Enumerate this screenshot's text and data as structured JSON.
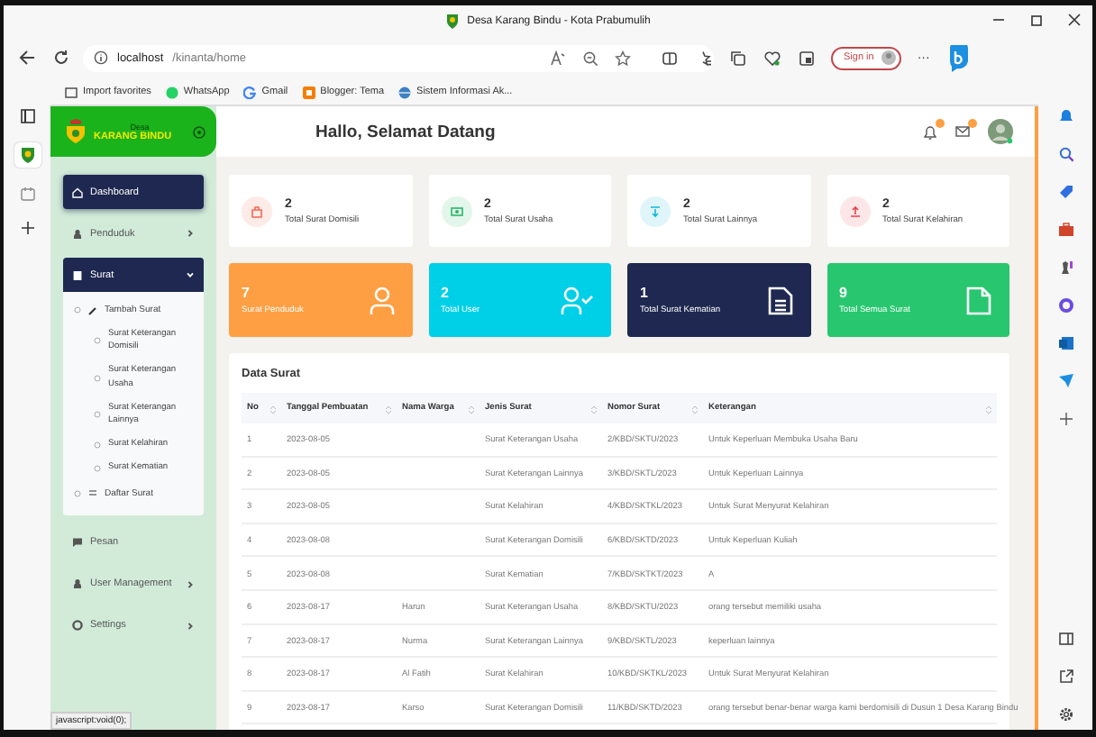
{
  "browser": {
    "title": "Desa Karang Bindu - Kota Prabumulih",
    "url_host": "localhost",
    "url_path": "/kinanta/home",
    "sign_in": "Sign in",
    "more": "···",
    "bookmarks": [
      {
        "label": "Import favorites",
        "kind": "import"
      },
      {
        "label": "WhatsApp",
        "kind": "whatsapp"
      },
      {
        "label": "Gmail",
        "kind": "google"
      },
      {
        "label": "Blogger: Tema",
        "kind": "blogger"
      },
      {
        "label": "Sistem Informasi Ak...",
        "kind": "globe"
      }
    ],
    "status_text": "javascript:void(0);"
  },
  "app": {
    "logo_top": "Desa",
    "logo": "KARANG BINDU",
    "greeting": "Hallo, Selamat Datang",
    "sidebar": [
      {
        "label": "Dashboard",
        "kind": "home",
        "selected": true
      },
      {
        "label": "Penduduk",
        "kind": "people",
        "selected": false,
        "expanded": false
      },
      {
        "label": "Surat",
        "kind": "mail",
        "selected": false,
        "expanded": true,
        "children": [
          {
            "label": "Tambah Surat",
            "kind": "pen",
            "children": [
              {
                "label": "Surat Keterangan Domisili"
              },
              {
                "label": "Surat Keterangan Usaha"
              },
              {
                "label": "Surat Keterangan Lainnya"
              },
              {
                "label": "Surat Kelahiran"
              },
              {
                "label": "Surat Kematian"
              }
            ]
          },
          {
            "label": "Daftar Surat",
            "kind": "list"
          }
        ]
      },
      {
        "label": "Pesan",
        "kind": "chat",
        "selected": false
      },
      {
        "label": "User Management",
        "kind": "people",
        "selected": false,
        "expanded": false
      },
      {
        "label": "Settings",
        "kind": "gear",
        "selected": false,
        "expanded": false
      }
    ],
    "stat_cards": [
      {
        "value": "2",
        "label": "Total Surat Domisili",
        "color": "#f26b4f",
        "kind": "bag"
      },
      {
        "value": "2",
        "label": "Total Surat Usaha",
        "color": "#29b866",
        "kind": "money"
      },
      {
        "value": "2",
        "label": "Total Surat Lainnya",
        "color": "#11b7d8",
        "kind": "down"
      },
      {
        "value": "2",
        "label": "Total Surat Kelahiran",
        "color": "#e9414d",
        "kind": "up"
      }
    ],
    "big_cards": [
      {
        "value": "7",
        "label": "Surat Penduduk",
        "color": "#ff9f43",
        "kind": "user"
      },
      {
        "value": "2",
        "label": "Total User",
        "color": "#00cfe8",
        "kind": "user-check"
      },
      {
        "value": "1",
        "label": "Total Surat Kematian",
        "color": "#1e2850",
        "kind": "doc-lines"
      },
      {
        "value": "9",
        "label": "Total Semua Surat",
        "color": "#28c76f",
        "kind": "doc"
      }
    ],
    "table": {
      "title": "Data Surat",
      "columns": [
        "No",
        "Tanggal Pembuatan",
        "Nama Warga",
        "Jenis Surat",
        "Nomor Surat",
        "Keterangan"
      ],
      "rows": [
        [
          "1",
          "2023-08-05",
          "",
          "Surat Keterangan Usaha",
          "2/KBD/SKTU/2023",
          "Untuk Keperluan Membuka Usaha Baru"
        ],
        [
          "2",
          "2023-08-05",
          "",
          "Surat Keterangan Lainnya",
          "3/KBD/SKTL/2023",
          "Untuk Keperluan Lainnya"
        ],
        [
          "3",
          "2023-08-05",
          "",
          "Surat Kelahiran",
          "4/KBD/SKTKL/2023",
          "Untuk Surat Menyurat Kelahiran"
        ],
        [
          "4",
          "2023-08-08",
          "",
          "Surat Keterangan Domisili",
          "6/KBD/SKTD/2023",
          "Untuk Keperluan Kuliah"
        ],
        [
          "5",
          "2023-08-08",
          "",
          "Surat Kematian",
          "7/KBD/SKTKT/2023",
          "A"
        ],
        [
          "6",
          "2023-08-17",
          "Harun",
          "Surat Keterangan Usaha",
          "8/KBD/SKTU/2023",
          "orang tersebut memiliki usaha"
        ],
        [
          "7",
          "2023-08-17",
          "Nurma",
          "Surat Keterangan Lainnya",
          "9/KBD/SKTL/2023",
          "keperluan lainnya"
        ],
        [
          "8",
          "2023-08-17",
          "Al Fatih",
          "Surat Kelahiran",
          "10/KBD/SKTKL/2023",
          "Untuk Surat Menyurat Kelahiran"
        ],
        [
          "9",
          "2023-08-17",
          "Karso",
          "Surat Keterangan Domisili",
          "11/KBD/SKTD/2023",
          "orang tersebut benar-benar warga kami berdomisili di Dusun 1 Desa Karang Bindu"
        ]
      ]
    }
  }
}
